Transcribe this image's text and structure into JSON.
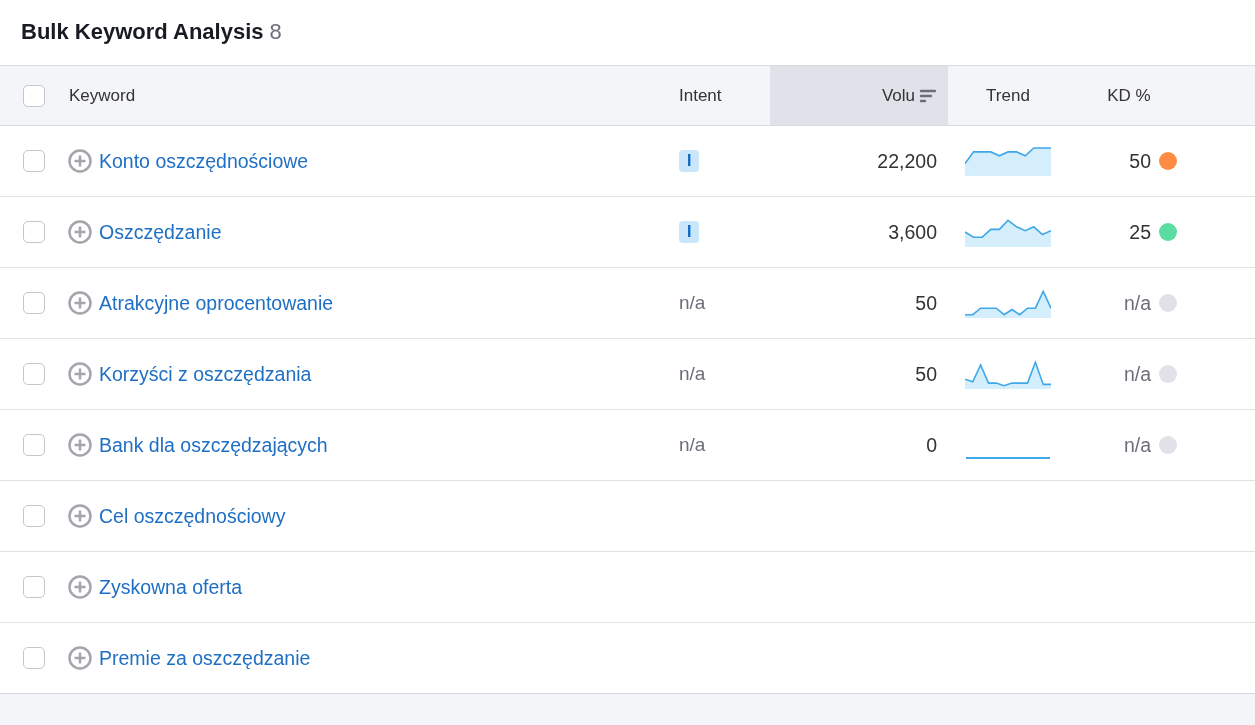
{
  "title": "Bulk Keyword Analysis",
  "count": "8",
  "select_all": {
    "checked": false
  },
  "columns": [
    {
      "label": "Keyword",
      "sorted": false
    },
    {
      "label": "Intent",
      "sorted": false
    },
    {
      "label": "Volu",
      "sorted": true
    },
    {
      "label": "Trend",
      "sorted": false
    },
    {
      "label": "KD %",
      "sorted": false
    }
  ],
  "rows": [
    {
      "checked": false,
      "keyword": "Konto oszczędnościowe",
      "intent": {
        "kind": "badge",
        "text": "I"
      },
      "volume": "22,200",
      "trend": {
        "kind": "area"
      },
      "kd": "50",
      "color": "#ff8c43"
    },
    {
      "checked": false,
      "keyword": "Oszczędzanie",
      "intent": {
        "kind": "badge",
        "text": "I"
      },
      "volume": "3,600",
      "trend": {
        "kind": "area"
      },
      "kd": "25",
      "color": "#59dda0"
    },
    {
      "checked": false,
      "keyword": "Atrakcyjne oprocentowanie",
      "intent": {
        "kind": "text",
        "text": "n/a"
      },
      "volume": "50",
      "trend": {
        "kind": "area"
      },
      "kd": "n/a",
      "color": "#e0e1e9"
    },
    {
      "checked": false,
      "keyword": "Korzyści z oszczędzania",
      "intent": {
        "kind": "text",
        "text": "n/a"
      },
      "volume": "50",
      "trend": {
        "kind": "area"
      },
      "kd": "n/a",
      "color": "#e0e1e9"
    },
    {
      "checked": false,
      "keyword": "Bank dla oszczędzających",
      "intent": {
        "kind": "text",
        "text": "n/a"
      },
      "volume": "0",
      "trend": {
        "kind": "flat"
      },
      "kd": "n/a",
      "color": "#e0e1e9"
    },
    {
      "checked": false,
      "keyword": "Cel oszczędnościowy"
    },
    {
      "checked": false,
      "keyword": "Zyskowna oferta"
    },
    {
      "checked": false,
      "keyword": "Premie za oszczędzanie"
    }
  ]
}
